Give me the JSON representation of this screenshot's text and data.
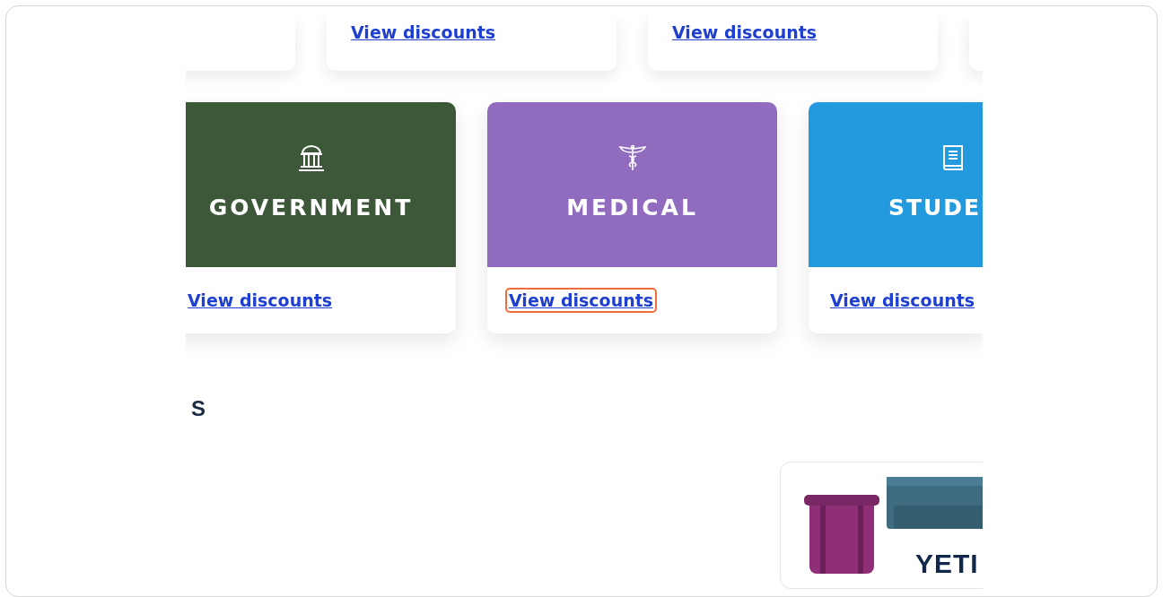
{
  "top_cards": [
    {
      "kind": "blank"
    },
    {
      "kind": "link",
      "link": "View discounts"
    },
    {
      "kind": "link",
      "link": "View discounts"
    },
    {
      "kind": "blank"
    }
  ],
  "categories": [
    {
      "title": "GOVERNMENT",
      "kind": "building",
      "color": "#3d5739",
      "link": "View discounts",
      "highlighted": false
    },
    {
      "title": "MEDICAL",
      "kind": "caduceus",
      "color": "#916bbd",
      "link": "View discounts",
      "highlighted": true
    },
    {
      "title": "STUDE",
      "kind": "book",
      "color": "#2399de",
      "link": "View discounts",
      "highlighted": false
    }
  ],
  "section_heading": "S",
  "product_card": {
    "kind": "picture",
    "brand": "YETI"
  }
}
